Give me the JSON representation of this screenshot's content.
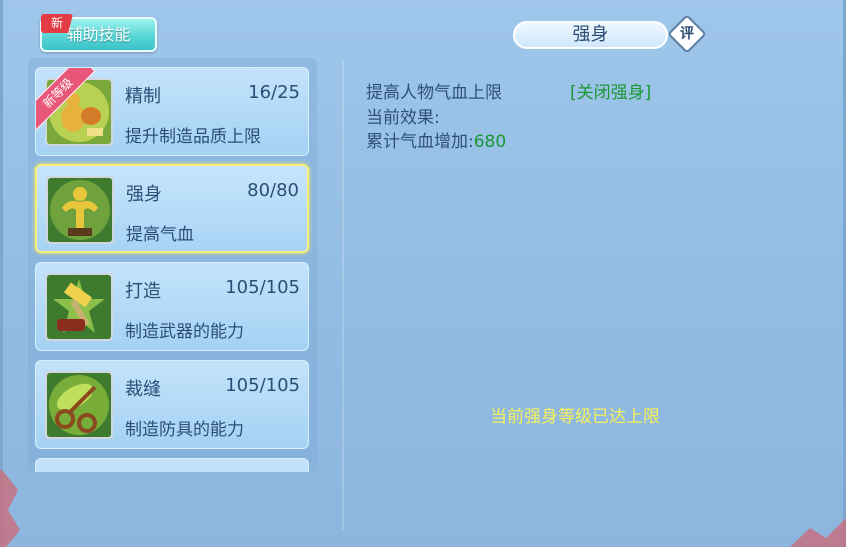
{
  "tab": {
    "label": "辅助技能",
    "new_badge": "新"
  },
  "skills": [
    {
      "name": "精制",
      "level": "16/25",
      "desc": "提升制造品质上限",
      "ribbon": "新等级"
    },
    {
      "name": "强身",
      "level": "80/80",
      "desc": "提高气血"
    },
    {
      "name": "打造",
      "level": "105/105",
      "desc": "制造武器的能力"
    },
    {
      "name": "裁缝",
      "level": "105/105",
      "desc": "制造防具的能力"
    }
  ],
  "detail": {
    "title": "强身",
    "review_label": "评",
    "line1": "提高人物气血上限",
    "toggle": "[关闭强身]",
    "effect_label": "当前效果:",
    "accum_label": "累计气血增加:",
    "accum_value": "680",
    "max_message": "当前强身等级已达上限"
  },
  "colors": {
    "accent_green": "#1a9633",
    "max_yellow": "#f6f05a",
    "selected_border": "#f8ef76"
  }
}
